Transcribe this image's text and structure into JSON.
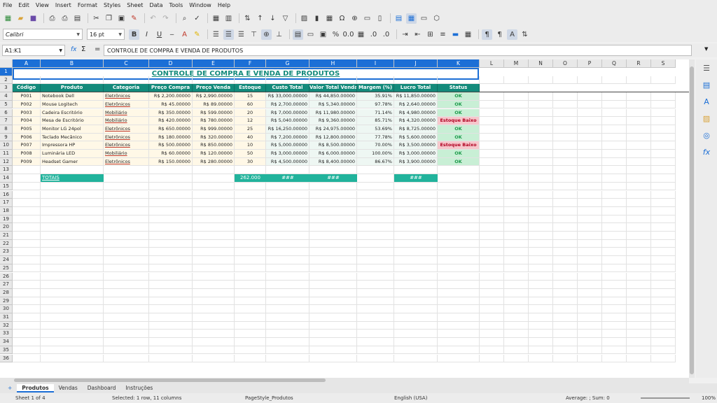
{
  "menu": [
    "File",
    "Edit",
    "View",
    "Insert",
    "Format",
    "Styles",
    "Sheet",
    "Data",
    "Tools",
    "Window",
    "Help"
  ],
  "font_name": "Calibri",
  "font_size": "16 pt",
  "name_box": "A1:K1",
  "formula_prefix": "fx",
  "sum_icon": "Σ",
  "equals_icon": "=",
  "formula": "CONTROLE DE COMPRA E VENDA DE PRODUTOS",
  "title": "CONTROLE DE COMPRA E VENDA DE PRODUTOS",
  "columns": [
    "A",
    "B",
    "C",
    "D",
    "E",
    "F",
    "G",
    "H",
    "I",
    "J",
    "K",
    "L",
    "M",
    "N",
    "O",
    "P",
    "Q",
    "R",
    "S"
  ],
  "rows": [
    "1",
    "2",
    "3",
    "4",
    "5",
    "6",
    "7",
    "8",
    "9",
    "10",
    "11",
    "12",
    "13",
    "14",
    "15",
    "16",
    "17",
    "18",
    "19",
    "20",
    "21",
    "22",
    "23",
    "24",
    "25",
    "26",
    "27",
    "28",
    "29",
    "30",
    "31",
    "32",
    "33",
    "34",
    "35",
    "36"
  ],
  "headers": [
    "Código",
    "Produto",
    "Categoria",
    "Preço Compra",
    "Preço Venda",
    "Estoque",
    "Custo Total",
    "Valor Total Venda",
    "Margem (%)",
    "Lucro Total",
    "Status"
  ],
  "data_rows": [
    [
      "P001",
      "Notebook Dell",
      "Eletrônicos",
      "R$ 2,200.00000",
      "R$ 2,990.00000",
      "15",
      "R$ 33,000.00000",
      "R$ 44,850.00000",
      "35.91%",
      "R$ 11,850.00000",
      "OK"
    ],
    [
      "P002",
      "Mouse Logitech",
      "Eletrônicos",
      "R$ 45.00000",
      "R$ 89.00000",
      "60",
      "R$ 2,700.00000",
      "R$ 5,340.00000",
      "97.78%",
      "R$ 2,640.00000",
      "OK"
    ],
    [
      "P003",
      "Cadeira Escritório",
      "Mobiliário",
      "R$ 350.00000",
      "R$ 599.00000",
      "20",
      "R$ 7,000.00000",
      "R$ 11,980.00000",
      "71.14%",
      "R$ 4,980.00000",
      "OK"
    ],
    [
      "P004",
      "Mesa de Escritório",
      "Mobiliário",
      "R$ 420.00000",
      "R$ 780.00000",
      "12",
      "R$ 5,040.00000",
      "R$ 9,360.00000",
      "85.71%",
      "R$ 4,320.00000",
      "Estoque Baixo"
    ],
    [
      "P005",
      "Monitor LG 24pol",
      "Eletrônicos",
      "R$ 650.00000",
      "R$ 999.00000",
      "25",
      "R$ 16,250.00000",
      "R$ 24,975.00000",
      "53.69%",
      "R$ 8,725.00000",
      "OK"
    ],
    [
      "P006",
      "Teclado Mecânico",
      "Eletrônicos",
      "R$ 180.00000",
      "R$ 320.00000",
      "40",
      "R$ 7,200.00000",
      "R$ 12,800.00000",
      "77.78%",
      "R$ 5,600.00000",
      "OK"
    ],
    [
      "P007",
      "Impressora HP",
      "Eletrônicos",
      "R$ 500.00000",
      "R$ 850.00000",
      "10",
      "R$ 5,000.00000",
      "R$ 8,500.00000",
      "70.00%",
      "R$ 3,500.00000",
      "Estoque Baixo"
    ],
    [
      "P008",
      "Luminária LED",
      "Mobiliário",
      "R$ 60.00000",
      "R$ 120.00000",
      "50",
      "R$ 3,000.00000",
      "R$ 6,000.00000",
      "100.00%",
      "R$ 3,000.00000",
      "OK"
    ],
    [
      "P009",
      "Headset Gamer",
      "Eletrônicos",
      "R$ 150.00000",
      "R$ 280.00000",
      "30",
      "R$ 4,500.00000",
      "R$ 8,400.00000",
      "86.67%",
      "R$ 3,900.00000",
      "OK"
    ]
  ],
  "totals": {
    "label": "TOTAIS",
    "estoque": "262.000",
    "custo": "###",
    "venda": "###",
    "lucro": "###"
  },
  "tabs": [
    "Produtos",
    "Vendas",
    "Dashboard",
    "Instruções"
  ],
  "status": {
    "sheet": "Sheet 1 of 4",
    "selection": "Selected: 1 row, 11 columns",
    "pagestyle": "PageStyle_Produtos",
    "language": "English (USA)",
    "stats": "Average: ; Sum: 0",
    "zoom": "100%"
  },
  "colors": {
    "header_bg": "#138a7b",
    "ok": "#c8efd5",
    "low": "#f6c7cc",
    "total": "#21b39c",
    "select": "#1c6fd6"
  }
}
